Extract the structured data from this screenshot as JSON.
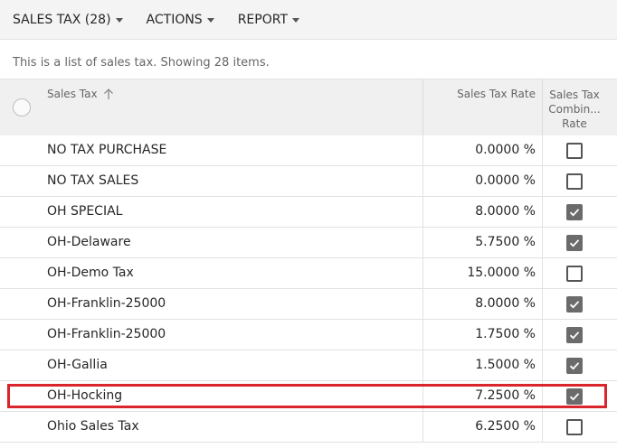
{
  "toolbar": {
    "sales_tax_label": "SALES TAX (28)",
    "actions_label": "ACTIONS",
    "report_label": "REPORT"
  },
  "info_text": "This is a list of sales tax. Showing 28 items.",
  "columns": {
    "name": "Sales Tax",
    "rate": "Sales Tax Rate",
    "combined_line1": "Sales Tax",
    "combined_line2": "Combin...",
    "combined_line3": "Rate"
  },
  "rows": [
    {
      "name": "NO TAX PURCHASE",
      "rate": "0.0000 %",
      "combined": false
    },
    {
      "name": "NO TAX SALES",
      "rate": "0.0000 %",
      "combined": false
    },
    {
      "name": "OH SPECIAL",
      "rate": "8.0000 %",
      "combined": true
    },
    {
      "name": "OH-Delaware",
      "rate": "5.7500 %",
      "combined": true
    },
    {
      "name": "OH-Demo Tax",
      "rate": "15.0000 %",
      "combined": false
    },
    {
      "name": "OH-Franklin-25000",
      "rate": "8.0000 %",
      "combined": true
    },
    {
      "name": "OH-Franklin-25000",
      "rate": "1.7500 %",
      "combined": true
    },
    {
      "name": "OH-Gallia",
      "rate": "1.5000 %",
      "combined": true
    },
    {
      "name": "OH-Hocking",
      "rate": "7.2500 %",
      "combined": true
    },
    {
      "name": "Ohio Sales Tax",
      "rate": "6.2500 %",
      "combined": false
    }
  ],
  "colors": {
    "highlight": "#d9252b",
    "checkbox_checked": "#6b6b6b"
  }
}
